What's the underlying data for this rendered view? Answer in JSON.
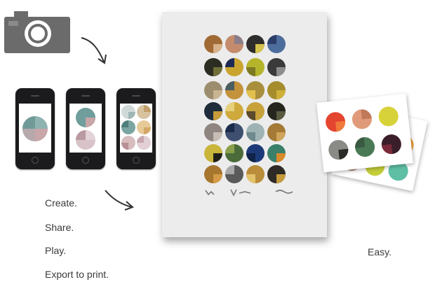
{
  "steps": [
    "Create.",
    "Share.",
    "Play.",
    "Export to print."
  ],
  "easy_label": "Easy.",
  "poster_signature": [
    "V&#x2f;m",
    "~",
    "~"
  ],
  "icons": [
    "camera-icon",
    "arrow-down-right-icon",
    "arrow-right-icon"
  ]
}
